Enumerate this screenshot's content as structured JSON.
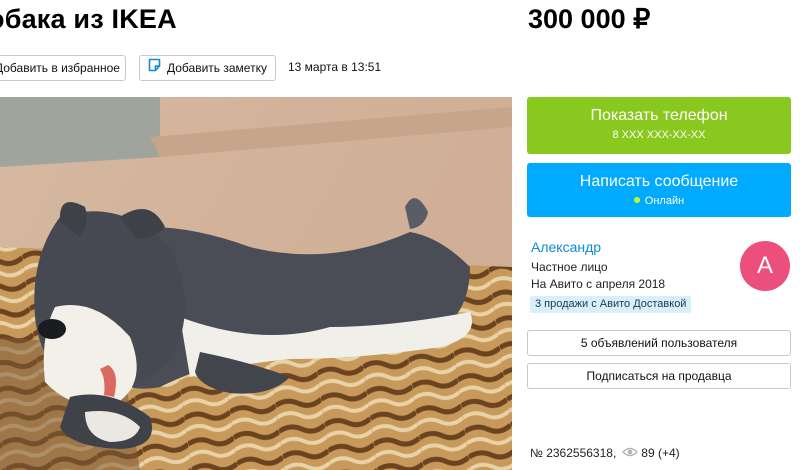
{
  "listing": {
    "title": "обака из IKEA",
    "price": "300 000 ₽",
    "date": "13 марта в 13:51",
    "id_text": "№ 2362556318,",
    "views": "89 (+4)"
  },
  "toolbar": {
    "favorite_label": "Добавить в избранное",
    "note_label": "Добавить заметку",
    "note_icon": "note-icon"
  },
  "photo": {
    "subject": "plush-dog-toy"
  },
  "contact": {
    "phone_label": "Показать телефон",
    "phone_masked": "8 XXX XXX-XX-XX",
    "message_label": "Написать сообщение",
    "online_label": "Онлайн"
  },
  "seller": {
    "name": "Александр",
    "type": "Частное лицо",
    "since": "На Авито с апреля 2018",
    "delivery_badge": "3 продажи с Авито Доставкой",
    "avatar_letter": "А",
    "ads_button": "5 объявлений пользователя",
    "subscribe_button": "Подписаться на продавца"
  },
  "colors": {
    "phone_button": "#88c81f",
    "message_button": "#00aaff",
    "seller_link": "#0a8ed6",
    "avatar": "#ec4f7c",
    "badge_bg": "#d8f0fc"
  }
}
